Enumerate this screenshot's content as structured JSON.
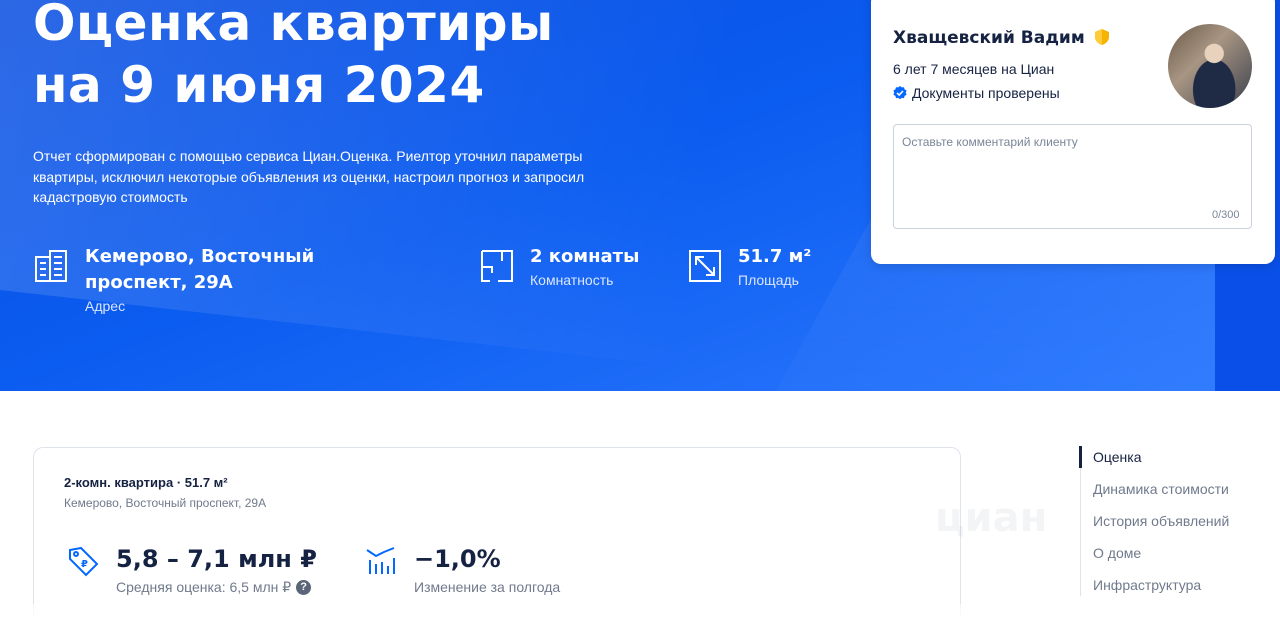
{
  "hero": {
    "title_line1": "Оценка квартиры",
    "title_line2": "на 9 июня 2024",
    "description": "Отчет сформирован с помощью сервиса Циан.Оценка. Риелтор уточнил параметры квартиры, исключил некоторые объявления из оценки, настроил прогноз и запросил кадастровую стоимость",
    "facts": {
      "address": {
        "value": "Кемерово, Восточный проспект, 29А",
        "label": "Адрес",
        "icon": "building-icon"
      },
      "rooms": {
        "value": "2 комнаты",
        "label": "Комнатность",
        "icon": "floorplan-icon"
      },
      "area": {
        "value": "51.7 м²",
        "label": "Площадь",
        "icon": "area-expand-icon"
      }
    }
  },
  "agent": {
    "name": "Хващевский Вадим",
    "tenure": "6 лет 7 месяцев на Циан",
    "verified": "Документы проверены",
    "comment_placeholder": "Оставьте комментарий клиенту",
    "char_count": "0/300"
  },
  "summary": {
    "title": "2-комн. квартира · 51.7 м²",
    "address": "Кемерово, Восточный проспект, 29А",
    "price": {
      "value": "5,8 – 7,1 млн ₽",
      "label": "Средняя оценка: 6,5 млн ₽",
      "help": "?"
    },
    "change": {
      "value": "−1,0%",
      "label": "Изменение за полгода"
    }
  },
  "anchor_nav": [
    {
      "label": "Оценка",
      "active": true
    },
    {
      "label": "Динамика стоимости",
      "active": false
    },
    {
      "label": "История объявлений",
      "active": false
    },
    {
      "label": "О доме",
      "active": false
    },
    {
      "label": "Инфраструктура",
      "active": false
    }
  ],
  "colors": {
    "brand_blue": "#0b5cf0",
    "text_dark": "#152242",
    "text_muted": "#707a8c",
    "shield_gold": "#f4b400",
    "verified_blue": "#0468ff"
  }
}
